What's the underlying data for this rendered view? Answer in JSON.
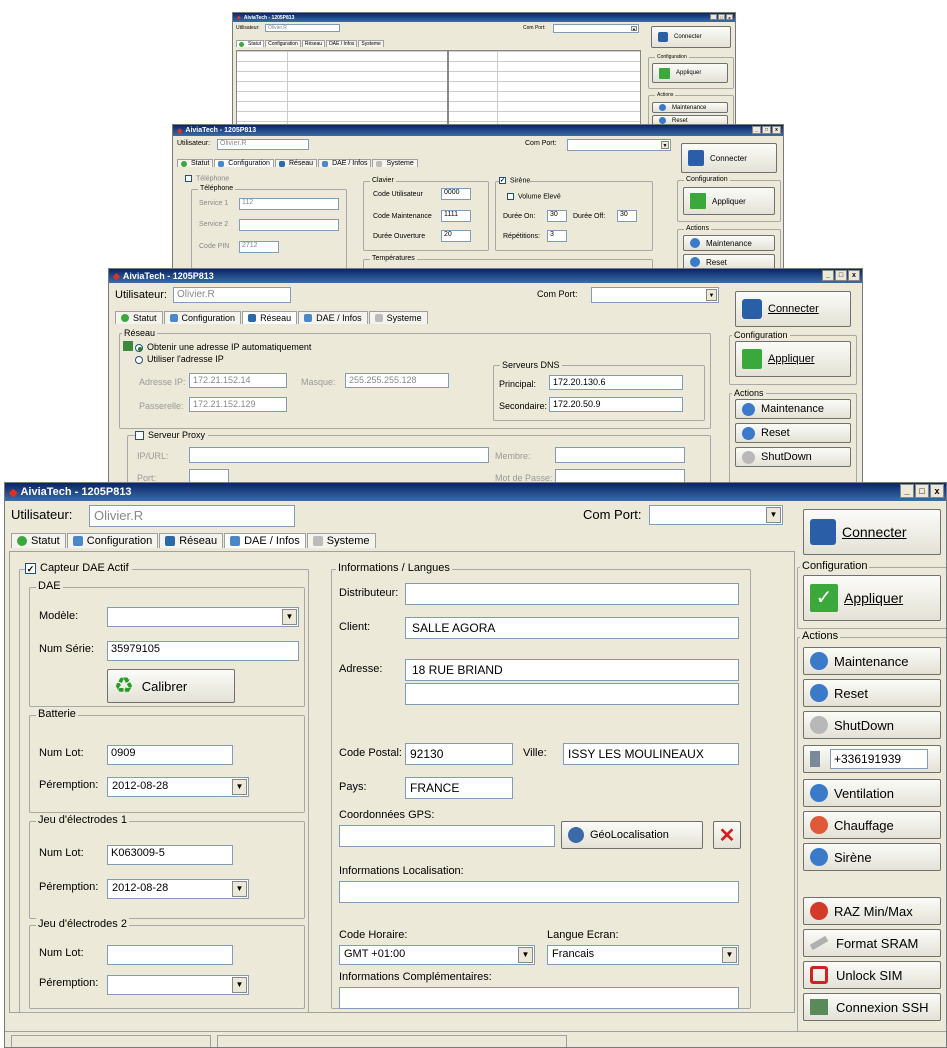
{
  "app": {
    "title": "AiviaTech - 1205P813",
    "user_label": "Utilisateur:",
    "user_value": "Olivier.R",
    "comport_label": "Com Port:",
    "comport_value": "",
    "connect_button": "Connecter"
  },
  "tabs": [
    "Statut",
    "Configuration",
    "Réseau",
    "DAE / Infos",
    "Systeme"
  ],
  "side": {
    "config_group": "Configuration",
    "apply_button": "Appliquer",
    "actions_group": "Actions",
    "maintenance": "Maintenance",
    "reset": "Reset",
    "shutdown": "ShutDown",
    "phone": "+336191939",
    "ventilation": "Ventilation",
    "chauffage": "Chauffage",
    "sirene": "Sirène",
    "raz": "RAZ Min/Max",
    "format": "Format SRAM",
    "unlock": "Unlock SIM",
    "ssh": "Connexion SSH"
  },
  "win2": {
    "tel_check": "Téléphone",
    "tel_group": "Téléphone",
    "service1_label": "Service 1",
    "service1_value": "112",
    "service2_label": "Service 2",
    "pin_label": "Code PIN",
    "pin_value": "2712",
    "clavier_group": "Clavier",
    "code_user_label": "Code Utilisateur",
    "code_user_value": "0000",
    "code_maint_label": "Code Maintenance",
    "code_maint_value": "1111",
    "duree_label": "Durée Ouverture",
    "duree_value": "20",
    "temp_group": "Températures",
    "sirene_check": "Sirène",
    "volume_check": "Volume Elevé",
    "dureeon_label": "Durée On:",
    "dureeon_value": "30",
    "dureeoff_label": "Durée Off:",
    "dureeoff_value": "30",
    "rep_label": "Répétitions:",
    "rep_value": "3"
  },
  "win3": {
    "reseau_group": "Réseau",
    "auto_ip": "Obtenir une adresse IP automatiquement",
    "use_ip": "Utiliser l'adresse IP",
    "ip_label": "Adresse IP:",
    "ip_value": "172.21.152.14",
    "mask_label": "Masque:",
    "mask_value": "255.255.255.128",
    "gw_label": "Passerelle:",
    "gw_value": "172.21.152.129",
    "dns_group": "Serveurs DNS",
    "dns1_label": "Principal:",
    "dns1_value": "172.20.130.6",
    "dns2_label": "Secondaire:",
    "dns2_value": "172.20.50.9",
    "proxy_check": "Serveur Proxy",
    "ipurl_label": "IP/URL:",
    "port_label": "Port:",
    "membre_label": "Membre:",
    "pass_label": "Mot de Passe:"
  },
  "dae": {
    "capteur_check": "Capteur DAE Actif",
    "dae_group": "DAE",
    "modele_label": "Modèle:",
    "modele_value": "",
    "serie_label": "Num Série:",
    "serie_value": "35979105",
    "calibrer": "Calibrer",
    "batterie_group": "Batterie",
    "lot_label": "Num Lot:",
    "bat_lot": "0909",
    "peremption_label": "Péremption:",
    "bat_date": "2012-08-28",
    "elec1_group": "Jeu d'électrodes 1",
    "elec1_lot": "K063009-5",
    "elec1_date": "2012-08-28",
    "elec2_group": "Jeu d'électrodes 2",
    "elec2_lot": "",
    "elec2_date": ""
  },
  "infos": {
    "group": "Informations / Langues",
    "distributeur_label": "Distributeur:",
    "distributeur_value": "",
    "client_label": "Client:",
    "client_value": "SALLE AGORA",
    "adresse_label": "Adresse:",
    "adresse1": "18 RUE BRIAND",
    "adresse2": "",
    "cp_label": "Code Postal:",
    "cp_value": "92130",
    "ville_label": "Ville:",
    "ville_value": "ISSY LES MOULINEAUX",
    "pays_label": "Pays:",
    "pays_value": "FRANCE",
    "gps_label": "Coordonnées GPS:",
    "gps_value": "",
    "geoloc": "GéoLocalisation",
    "loc_label": "Informations Localisation:",
    "loc_value": "",
    "horaire_label": "Code Horaire:",
    "horaire_value": "GMT +01:00",
    "langue_label": "Langue Ecran:",
    "langue_value": "Francais",
    "compl_label": "Informations Complémentaires:",
    "compl_value": ""
  },
  "colors": {
    "titlebar": "#0a246a",
    "window_bg": "#ece9d8",
    "green_check": "#3aa83a",
    "red_x": "#d42020"
  }
}
